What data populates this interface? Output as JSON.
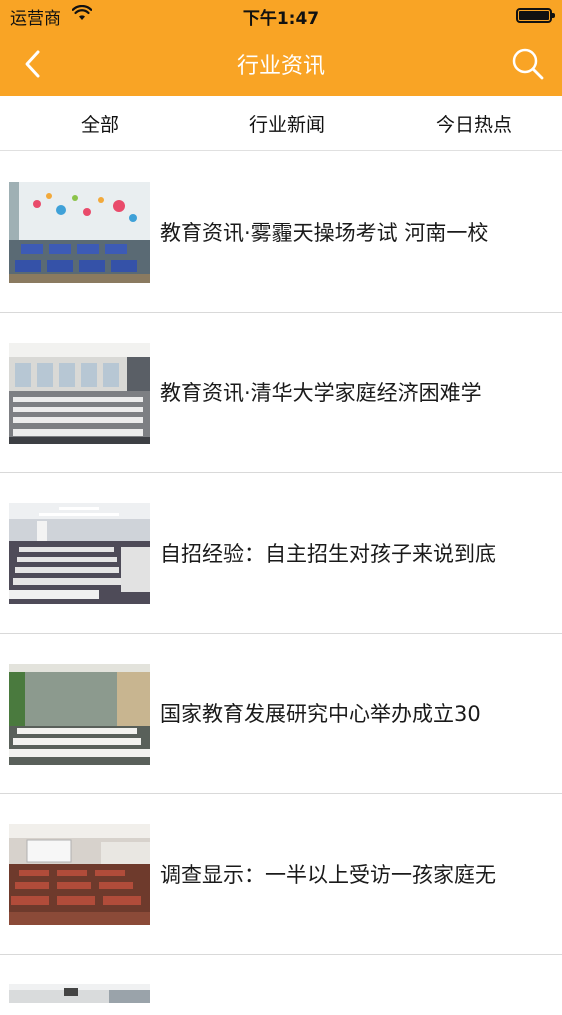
{
  "status_bar": {
    "carrier": "运营商",
    "time": "下午1:47",
    "battery_level": 1.0
  },
  "nav": {
    "title": "行业资讯",
    "back_icon": "chevron-left-icon",
    "search_icon": "search-icon"
  },
  "tabs": [
    {
      "label": "全部"
    },
    {
      "label": "行业新闻"
    },
    {
      "label": "今日热点"
    }
  ],
  "articles": [
    {
      "title": "教育资讯·雾霾天操场考试 河南一校"
    },
    {
      "title": "教育资讯·清华大学家庭经济困难学"
    },
    {
      "title": "自招经验：自主招生对孩子来说到底"
    },
    {
      "title": "国家教育发展研究中心举办成立30"
    },
    {
      "title": "调查显示：一半以上受访一孩家庭无"
    }
  ],
  "colors": {
    "header": "#f9a425",
    "text": "#1a1a1a",
    "divider": "#d9d9d9"
  }
}
